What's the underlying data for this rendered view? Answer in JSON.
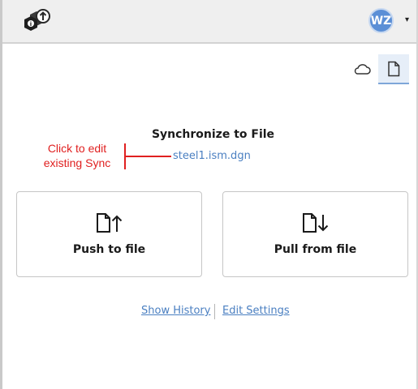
{
  "header": {
    "logo_icon": "itwin-sync-logo-icon",
    "user_initials": "WZ",
    "avatar_color": "#5b8fd6",
    "menu_caret_icon": "caret-down-icon"
  },
  "view_toggle": {
    "cloud_icon": "cloud-icon",
    "file_icon": "file-icon",
    "active": "file"
  },
  "main": {
    "title": "Synchronize to File",
    "file_name": "steel1.ism.dgn",
    "annotation_line1": "Click to edit",
    "annotation_line2": "existing Sync"
  },
  "cards": {
    "push_label": "Push to file",
    "push_icon": "file-arrow-up-icon",
    "pull_label": "Pull from file",
    "pull_icon": "file-arrow-down-icon"
  },
  "links": {
    "show_history": "Show History",
    "edit_settings": "Edit Settings"
  },
  "colors": {
    "accent": "#4a7fc1",
    "annotation": "#e02020",
    "header_bg": "#efefef"
  }
}
